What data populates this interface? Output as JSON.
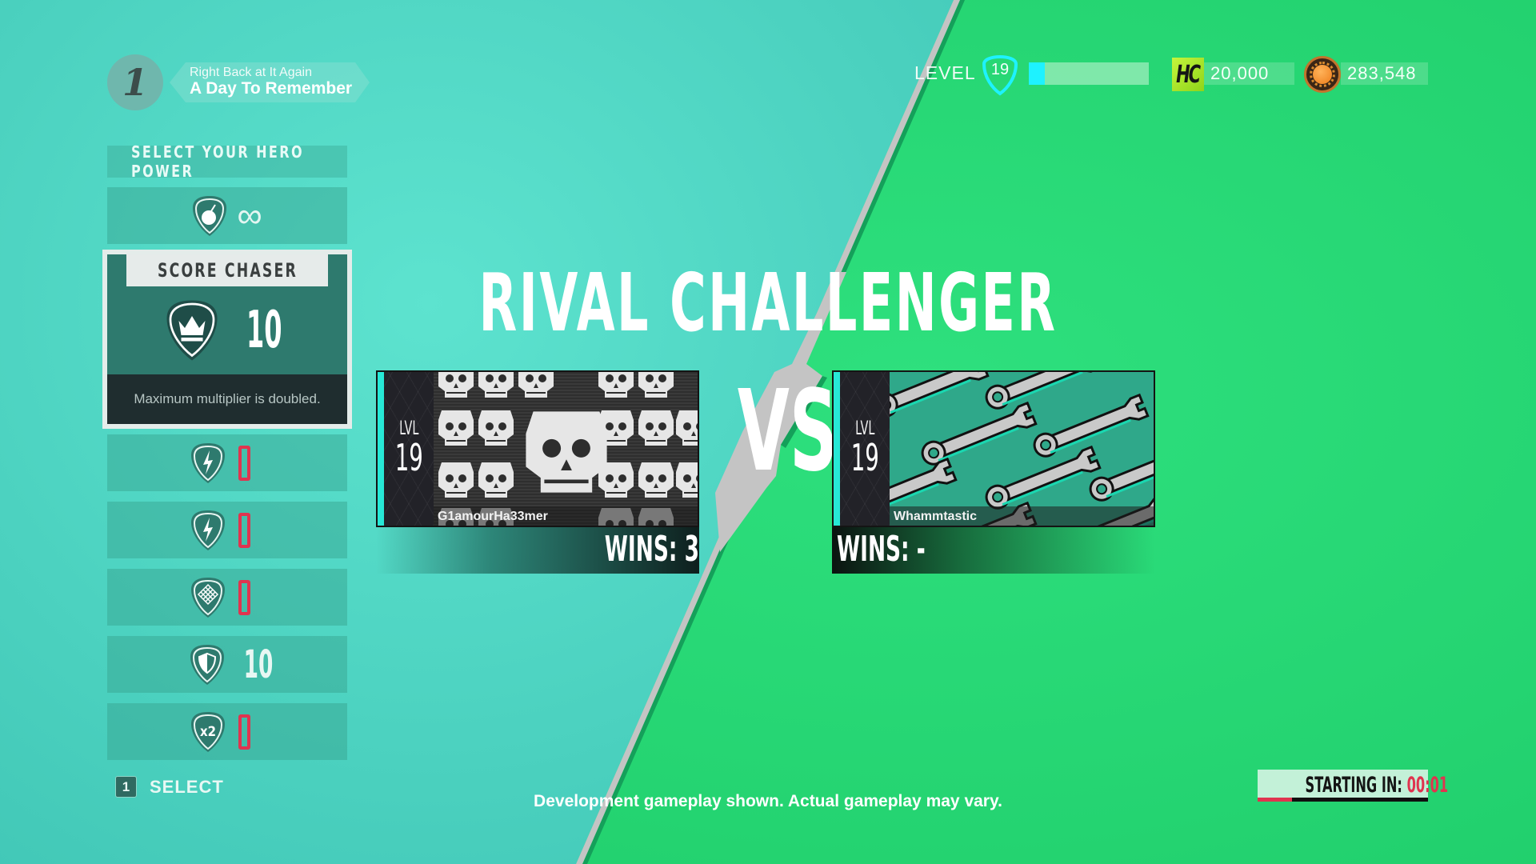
{
  "now_playing": {
    "track_number": "1",
    "song_title": "Right Back at It Again",
    "artist": "A Day To Remember"
  },
  "hero_power": {
    "header": "SELECT YOUR HERO POWER",
    "cards": [
      {
        "icon": "bomb-icon",
        "value": "∞",
        "kind": "infinite"
      },
      {
        "icon": "lightning-icon",
        "value": "0",
        "kind": "zero"
      },
      {
        "icon": "lightning-icon",
        "value": "0",
        "kind": "zero"
      },
      {
        "icon": "net-icon",
        "value": "0",
        "kind": "zero"
      },
      {
        "icon": "shield-half-icon",
        "value": "10",
        "kind": "count"
      },
      {
        "icon": "x2-icon",
        "value": "0",
        "kind": "zero"
      }
    ],
    "selected": {
      "title": "SCORE CHASER",
      "icon": "crown-icon",
      "value": "10",
      "description": "Maximum multiplier is doubled."
    },
    "select_hint": {
      "key": "1",
      "label": "SELECT"
    }
  },
  "hud": {
    "level_label": "LEVEL",
    "level": "19",
    "level_progress": 0.13,
    "hero_cash": "20,000",
    "coins": "283,548"
  },
  "matchup": {
    "title": "RIVAL CHALLENGER",
    "vs": "VS",
    "player": {
      "lvl_label": "LVL",
      "level": "19",
      "name": "G1amourHa33mer",
      "wins": "WINS: 3"
    },
    "rival": {
      "lvl_label": "LVL",
      "level": "19",
      "name": "Whammtastic",
      "wins": "WINS: -"
    }
  },
  "countdown": {
    "label": "STARTING IN:",
    "value": "00:01",
    "progress": 0.2
  },
  "disclaimer": "Development gameplay shown. Actual gameplay may vary.",
  "colors": {
    "left_bg": "#48ccbb",
    "right_bg": "#22d270",
    "accent_red": "#e0344f",
    "accent_cyan": "#1ef2ff"
  }
}
